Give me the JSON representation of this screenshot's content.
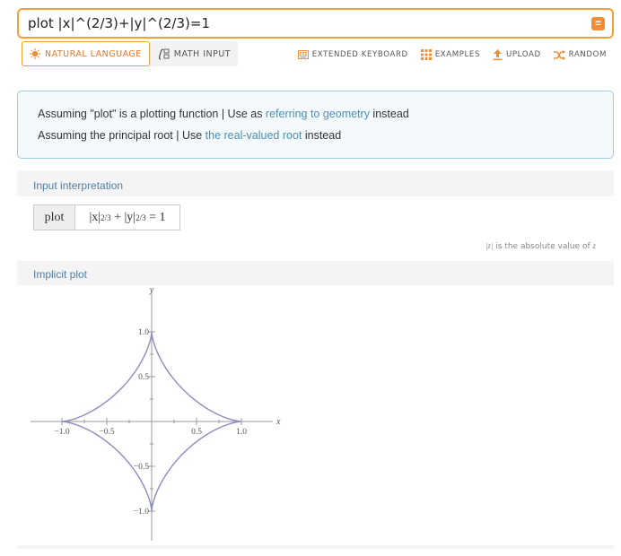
{
  "search": {
    "query": "plot |x|^(2/3)+|y|^(2/3)=1",
    "submit_symbol": "="
  },
  "modes": {
    "natural_language": "NATURAL LANGUAGE",
    "math_input": "MATH INPUT"
  },
  "toolbar": {
    "extended_keyboard": "EXTENDED KEYBOARD",
    "examples": "EXAMPLES",
    "upload": "UPLOAD",
    "random": "RANDOM"
  },
  "assumptions": {
    "line1_prefix": "Assuming \"plot\" is a plotting function | Use as ",
    "line1_link": "referring to geometry",
    "line1_suffix": " instead",
    "line2_prefix": "Assuming the principal root | Use ",
    "line2_link": "the real-valued root",
    "line2_suffix": " instead"
  },
  "input_interpretation": {
    "title": "Input interpretation",
    "cell1": "plot",
    "cell2_a": "|x|",
    "cell2_exp1": "2/3",
    "cell2_b": " + |y|",
    "cell2_exp2": "2/3",
    "cell2_c": " = 1",
    "footnote_var": "|z|",
    "footnote_text": " is the absolute value of ",
    "footnote_z": "z"
  },
  "implicit_plot": {
    "title": "Implicit plot"
  },
  "chart_data": {
    "type": "line",
    "title": "",
    "xlabel": "x",
    "ylabel": "y",
    "xlim": [
      -1.0,
      1.0
    ],
    "ylim": [
      -1.0,
      1.0
    ],
    "x_ticks": [
      "-1.0",
      "-0.5",
      "0.5",
      "1.0"
    ],
    "y_ticks": [
      "1.0",
      "0.5",
      "-0.5",
      "-1.0"
    ],
    "series": [
      {
        "equation": "|x|^(2/3)+|y|^(2/3)=1",
        "color": "#8c8cc0"
      }
    ]
  }
}
